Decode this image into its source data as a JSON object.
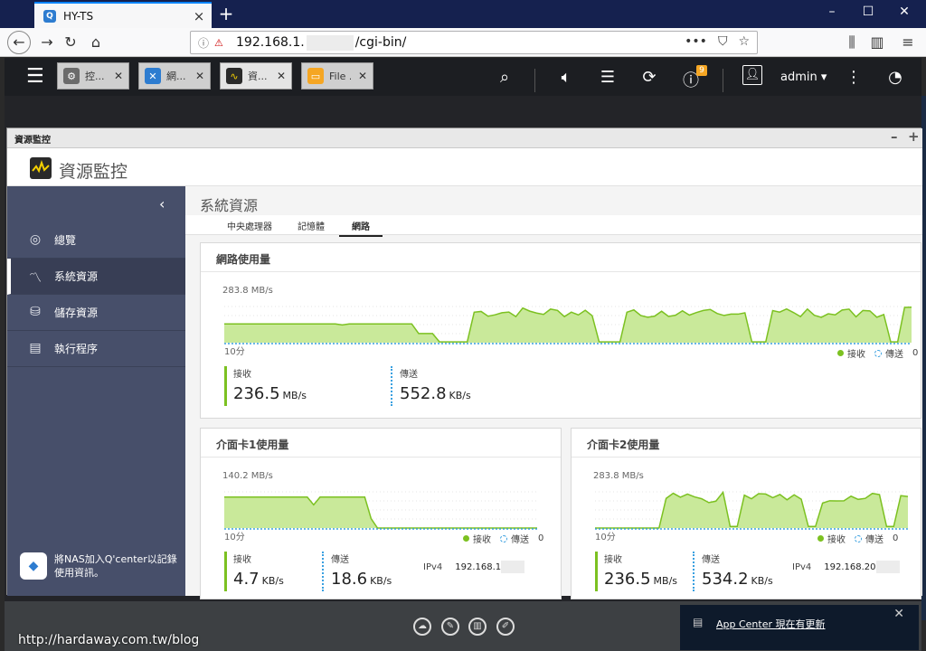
{
  "browser": {
    "tab_title": "HY-TS",
    "tab_icon": "Q",
    "url_host": "192.168.1.",
    "url_path": "/cgi-bin/"
  },
  "qts": {
    "tabs": [
      {
        "label": "控...",
        "icon": "gear-icon",
        "color": "#6b6b6b"
      },
      {
        "label": "網...",
        "icon": "network-icon",
        "color": "#2d7cd0"
      },
      {
        "label": "資...",
        "icon": "monitor-icon",
        "color": "#2a2a2a"
      },
      {
        "label": "File ...",
        "icon": "folder-icon",
        "color": "#f5a623"
      }
    ],
    "notification_count": "9",
    "user": "admin ▾"
  },
  "window": {
    "title": "資源監控",
    "app_title": "資源監控"
  },
  "sidebar": {
    "items": [
      {
        "label": "總覽",
        "icon": "gauge-icon"
      },
      {
        "label": "系統資源",
        "icon": "chart-icon"
      },
      {
        "label": "儲存資源",
        "icon": "storage-icon"
      },
      {
        "label": "執行程序",
        "icon": "process-icon"
      }
    ],
    "qcenter_text": "將NAS加入Q'center以記錄使用資訊。"
  },
  "content": {
    "title": "系統資源",
    "tabs": [
      "中央處理器",
      "記憶體",
      "網路"
    ],
    "active_tab": "網路"
  },
  "cards": {
    "network": {
      "title": "網路使用量",
      "axis_max": "283.8 MB/s",
      "axis_min": "10分",
      "axis_zero": "0",
      "legend_rx": "接收",
      "legend_tx": "傳送",
      "rx_label": "接收",
      "rx_value": "236.5",
      "rx_unit": "MB/s",
      "tx_label": "傳送",
      "tx_value": "552.8",
      "tx_unit": "KB/s"
    },
    "nic1": {
      "title": "介面卡1使用量",
      "axis_max": "140.2 MB/s",
      "axis_min": "10分",
      "axis_zero": "0",
      "legend_rx": "接收",
      "legend_tx": "傳送",
      "rx_label": "接收",
      "rx_value": "4.7",
      "rx_unit": "KB/s",
      "tx_label": "傳送",
      "tx_value": "18.6",
      "tx_unit": "KB/s",
      "ip_label": "IPv4",
      "ip_value": "192.168.1"
    },
    "nic2": {
      "title": "介面卡2使用量",
      "axis_max": "283.8 MB/s",
      "axis_min": "10分",
      "axis_zero": "0",
      "legend_rx": "接收",
      "legend_tx": "傳送",
      "rx_label": "接收",
      "rx_value": "236.5",
      "rx_unit": "MB/s",
      "tx_label": "傳送",
      "tx_value": "534.2",
      "tx_unit": "KB/s",
      "ip_label": "IPv4",
      "ip_value": "192.168.20"
    }
  },
  "notification": {
    "link": "App Center 現在有更新"
  },
  "watermark": "http://hardaway.com.tw/blog",
  "colors": {
    "rx": "#7cc121",
    "rx_fill": "#c9e99a",
    "tx": "#3aa0e0",
    "sidebar": "#474f6a"
  },
  "chart_data": [
    {
      "type": "area",
      "name": "network",
      "ylim": [
        0,
        283.8
      ],
      "unit": "MB/s",
      "series": [
        {
          "name": "接收",
          "values": [
            150,
            150,
            150,
            150,
            150,
            150,
            150,
            150,
            150,
            150,
            150,
            150,
            150,
            150,
            150,
            150,
            150,
            150,
            150,
            150,
            150,
            150,
            150,
            150,
            150,
            150,
            150,
            150,
            150,
            150,
            150,
            150,
            150,
            150,
            150,
            150,
            150,
            150,
            150,
            150,
            150,
            150,
            150,
            150,
            150,
            150,
            150,
            150,
            150,
            150,
            150,
            150,
            150,
            150,
            150,
            150,
            150,
            150,
            150,
            150,
            150,
            150,
            150,
            150,
            150,
            150,
            150,
            150,
            150,
            150,
            150,
            150,
            150,
            150,
            150,
            150,
            150,
            150,
            150,
            150,
            150,
            150,
            150,
            150,
            150,
            150,
            150,
            150,
            150,
            150,
            150,
            150,
            150,
            150,
            150,
            150,
            150,
            150,
            150,
            150,
            150,
            150,
            150,
            150,
            150,
            150,
            150,
            150,
            150,
            150,
            150,
            150,
            150,
            150,
            150,
            150,
            150,
            150,
            150,
            150,
            150,
            150,
            150,
            150,
            150,
            150,
            150,
            150,
            150,
            150,
            150,
            150,
            150,
            150,
            150,
            150,
            150,
            150,
            150,
            150,
            150,
            150,
            150,
            150,
            150,
            150,
            150,
            150,
            150,
            150
          ]
        }
      ]
    }
  ]
}
